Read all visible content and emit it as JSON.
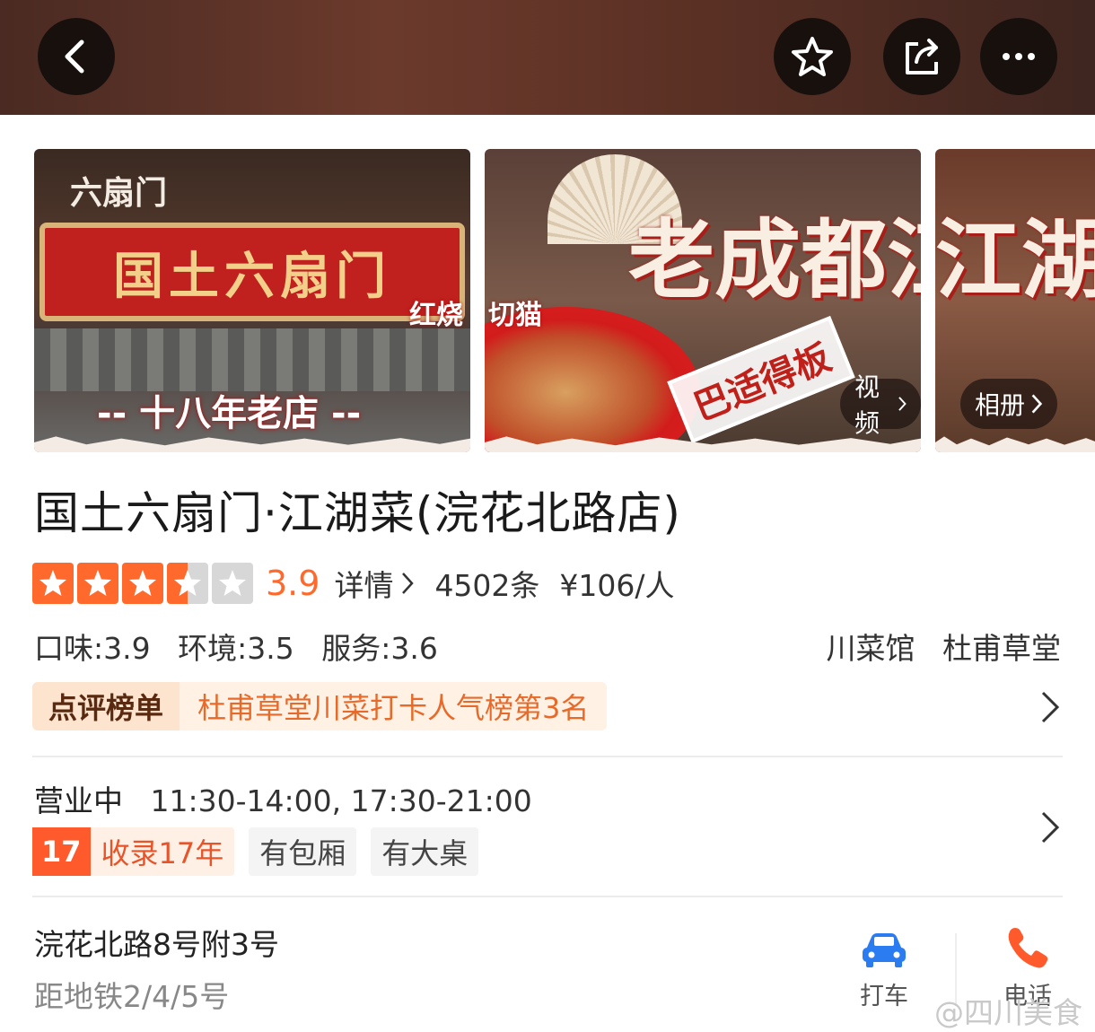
{
  "colors": {
    "accent": "#ff6a2c",
    "star_empty": "#d7d7d7",
    "phone": "#ff5a2c",
    "car": "#2a7cf0",
    "rank_text": "#e86a2a"
  },
  "topbar": {
    "back_icon": "chevron-left-icon",
    "favorite_icon": "star-outline-icon",
    "share_icon": "share-icon",
    "more_icon": "more-dots-icon"
  },
  "photos": {
    "photo1": {
      "brand_small": "六扇门",
      "banner": "国土六扇门",
      "side_text": "红烧",
      "bottom_tag": "-- 十八年老店 --"
    },
    "photo2": {
      "fan_icon": "folding-fan-icon",
      "title": "老成都江湖",
      "dish": "切猫",
      "stamp": "巴适得板"
    },
    "video_label": "视频",
    "album_label": "相册"
  },
  "shop": {
    "title": "国土六扇门·江湖菜(浣花北路店)"
  },
  "rating": {
    "stars": 3.5,
    "score": "3.9",
    "detail_label": "详情",
    "reviews": "4502条",
    "price": "¥106/人"
  },
  "sub_scores": {
    "taste": "口味:3.9",
    "environment": "环境:3.5",
    "service": "服务:3.6"
  },
  "categories": [
    "川菜馆",
    "杜甫草堂"
  ],
  "ranking": {
    "badge": "点评榜单",
    "text": "杜甫草堂川菜打卡人气榜第3名"
  },
  "hours": {
    "status": "营业中",
    "times": "11:30-14:00, 17:30-21:00"
  },
  "tags": {
    "years_number": "17",
    "years_label": "收录17年",
    "items": [
      "有包厢",
      "有大桌"
    ]
  },
  "address": {
    "line": "浣花北路8号附3号",
    "distance": "距地铁2/4/5号"
  },
  "actions": {
    "taxi_label": "打车",
    "phone_label": "电话"
  },
  "watermark": "@四川美食"
}
